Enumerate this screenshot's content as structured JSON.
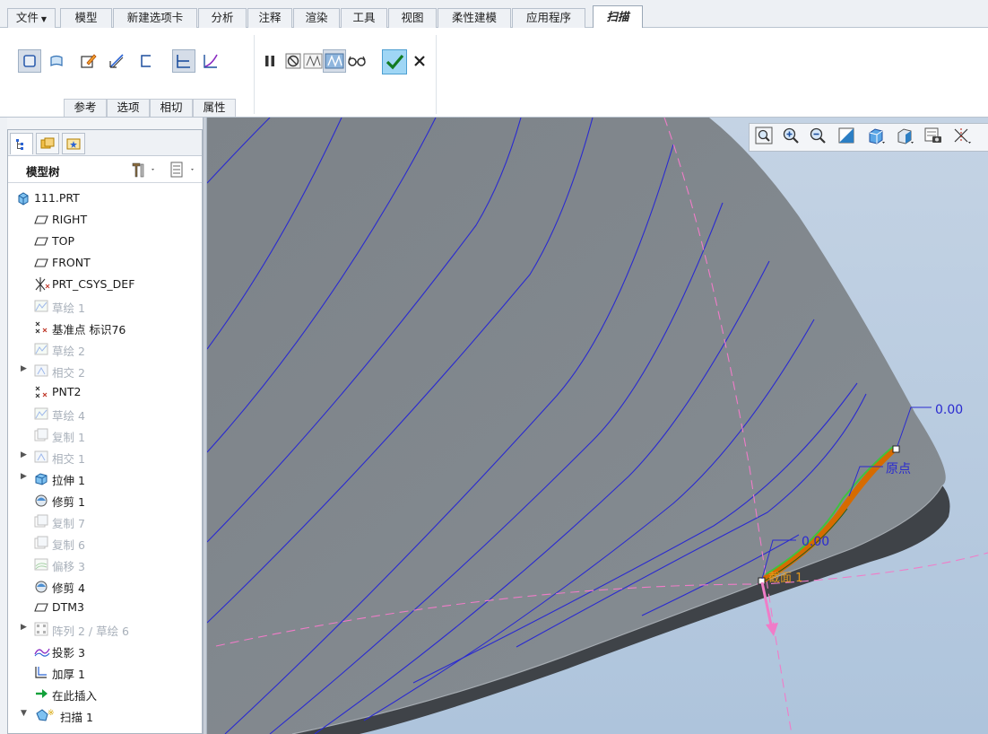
{
  "menu_tabs": [
    {
      "label": "文件",
      "has_dropdown": true
    },
    {
      "label": "模型"
    },
    {
      "label": "新建选项卡"
    },
    {
      "label": "分析"
    },
    {
      "label": "注释"
    },
    {
      "label": "渲染"
    },
    {
      "label": "工具"
    },
    {
      "label": "视图"
    },
    {
      "label": "柔性建模"
    },
    {
      "label": "应用程序"
    },
    {
      "label": "扫描",
      "active": true
    }
  ],
  "ribbon": {
    "subtabs": [
      "参考",
      "选项",
      "相切",
      "属性"
    ],
    "buttons": [
      "solid-icon",
      "surface-icon",
      "sketch-edit-icon",
      "thicken-icon",
      "remove-material-icon",
      "constant-section-icon",
      "variable-section-icon",
      "pause-icon",
      "no-preview-icon",
      "preview-geometry-icon",
      "preview-feature-icon",
      "verify-icon",
      "ok-check-icon",
      "cancel-x-icon"
    ]
  },
  "model_tree": {
    "title": "模型树",
    "items": [
      {
        "label": "111.PRT",
        "icon": "part-icon",
        "state": "normal",
        "expand": ""
      },
      {
        "label": "RIGHT",
        "icon": "datum-plane-icon",
        "state": "normal",
        "expand": ""
      },
      {
        "label": "TOP",
        "icon": "datum-plane-icon",
        "state": "normal",
        "expand": ""
      },
      {
        "label": "FRONT",
        "icon": "datum-plane-icon",
        "state": "normal",
        "expand": ""
      },
      {
        "label": "PRT_CSYS_DEF",
        "icon": "csys-icon",
        "state": "normal",
        "expand": ""
      },
      {
        "label": "草绘 1",
        "icon": "sketch-icon",
        "state": "dim",
        "expand": ""
      },
      {
        "label": "基准点 标识76",
        "icon": "datum-point-icon",
        "state": "normal",
        "expand": ""
      },
      {
        "label": "草绘 2",
        "icon": "sketch-icon",
        "state": "dim",
        "expand": ""
      },
      {
        "label": "相交 2",
        "icon": "intersect-icon",
        "state": "dim",
        "expand": "▶"
      },
      {
        "label": "PNT2",
        "icon": "datum-point-icon",
        "state": "normal",
        "expand": ""
      },
      {
        "label": "草绘 4",
        "icon": "sketch-icon",
        "state": "dim",
        "expand": ""
      },
      {
        "label": "复制 1",
        "icon": "copy-icon",
        "state": "dim",
        "expand": ""
      },
      {
        "label": "相交 1",
        "icon": "intersect-icon",
        "state": "dim",
        "expand": "▶"
      },
      {
        "label": "拉伸 1",
        "icon": "extrude-icon",
        "state": "normal",
        "expand": "▶"
      },
      {
        "label": "修剪 1",
        "icon": "trim-icon",
        "state": "normal",
        "expand": ""
      },
      {
        "label": "复制 7",
        "icon": "copy-icon",
        "state": "dim",
        "expand": ""
      },
      {
        "label": "复制 6",
        "icon": "copy-icon",
        "state": "dim",
        "expand": ""
      },
      {
        "label": "偏移 3",
        "icon": "offset-icon",
        "state": "dim",
        "expand": ""
      },
      {
        "label": "修剪 4",
        "icon": "trim-icon",
        "state": "normal",
        "expand": ""
      },
      {
        "label": "DTM3",
        "icon": "datum-plane-icon",
        "state": "normal",
        "expand": ""
      },
      {
        "label": "阵列 2 / 草绘 6",
        "icon": "pattern-icon",
        "state": "dim",
        "expand": "▶"
      },
      {
        "label": "投影 3",
        "icon": "project-icon",
        "state": "normal",
        "expand": ""
      },
      {
        "label": "加厚 1",
        "icon": "thicken-icon",
        "state": "normal",
        "expand": ""
      },
      {
        "label": "在此插入",
        "icon": "insert-here-icon",
        "state": "normal",
        "expand": ""
      },
      {
        "label": "扫描 1",
        "icon": "sweep-icon",
        "state": "normal",
        "expand": "▼"
      }
    ]
  },
  "viewport": {
    "dimension_top": "0.00",
    "dimension_bottom": "0.00",
    "origin_label": "原点",
    "section_label": "截面 1"
  },
  "view_toolbar": [
    "refit-icon",
    "zoom-in-icon",
    "zoom-out-icon",
    "repaint-icon",
    "display-style-icon",
    "saved-views-icon",
    "view-manager-icon",
    "datum-display-icon"
  ],
  "colors": {
    "accent_blue": "#2a63d4",
    "model_gray": "#7e858b",
    "background_sky": "#b5c9df",
    "datum_pink": "#f07cc8",
    "sweep_orange": "#d66b00",
    "sweep_green": "#3fc23f"
  }
}
